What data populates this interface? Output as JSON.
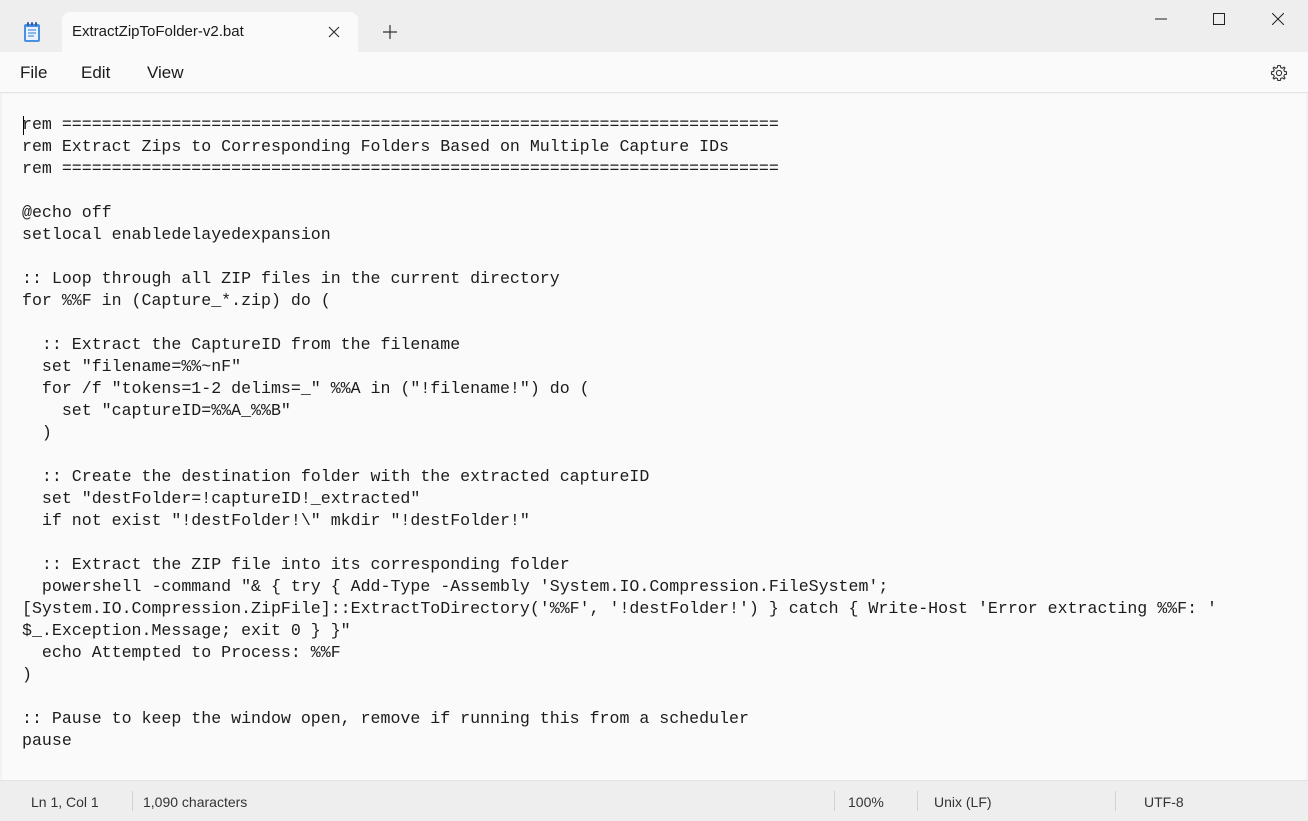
{
  "tab": {
    "title": "ExtractZipToFolder-v2.bat"
  },
  "menu": {
    "file": "File",
    "edit": "Edit",
    "view": "View"
  },
  "code_lines": [
    "rem ========================================================================",
    "rem Extract Zips to Corresponding Folders Based on Multiple Capture IDs",
    "rem ========================================================================",
    "",
    "@echo off",
    "setlocal enabledelayedexpansion",
    "",
    ":: Loop through all ZIP files in the current directory",
    "for %%F in (Capture_*.zip) do (",
    "",
    "  :: Extract the CaptureID from the filename",
    "  set \"filename=%%~nF\"",
    "  for /f \"tokens=1-2 delims=_\" %%A in (\"!filename!\") do (",
    "    set \"captureID=%%A_%%B\"",
    "  )",
    "",
    "  :: Create the destination folder with the extracted captureID",
    "  set \"destFolder=!captureID!_extracted\"",
    "  if not exist \"!destFolder!\\\" mkdir \"!destFolder!\"",
    "",
    "  :: Extract the ZIP file into its corresponding folder",
    "  powershell -command \"& { try { Add-Type -Assembly 'System.IO.Compression.FileSystem';",
    "[System.IO.Compression.ZipFile]::ExtractToDirectory('%%F', '!destFolder!') } catch { Write-Host 'Error extracting %%F: '",
    "$_.Exception.Message; exit 0 } }\"",
    "  echo Attempted to Process: %%F",
    ")",
    "",
    ":: Pause to keep the window open, remove if running this from a scheduler",
    "pause"
  ],
  "status": {
    "position": "Ln 1, Col 1",
    "characters": "1,090 characters",
    "zoom": "100%",
    "line_ending": "Unix (LF)",
    "encoding": "UTF-8"
  },
  "icons": {
    "app": "notepad-icon",
    "tab_close": "close-icon",
    "new_tab": "plus-icon",
    "minimize": "minimize-icon",
    "maximize": "maximize-icon",
    "close": "close-icon",
    "settings": "gear-icon"
  },
  "colors": {
    "accent": "#2b6fd6"
  }
}
